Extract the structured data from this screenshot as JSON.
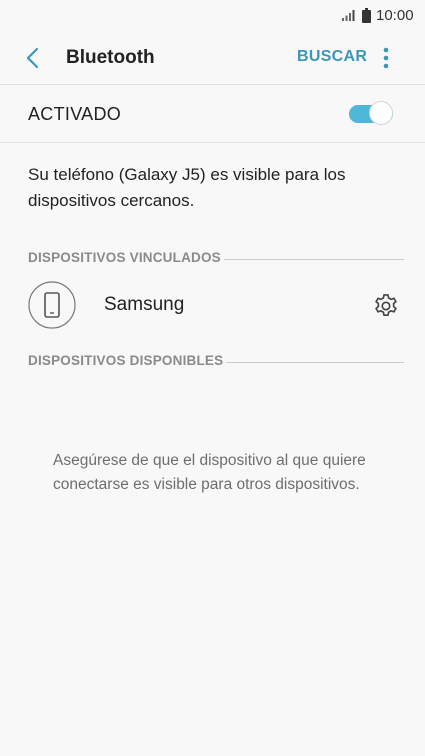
{
  "status_bar": {
    "time": "10:00",
    "icons": [
      "signal-icon",
      "battery-icon"
    ]
  },
  "app_bar": {
    "back_icon": "back-arrow-icon",
    "title": "Bluetooth",
    "action_label": "BUSCAR",
    "more_icon": "more-vert-icon"
  },
  "master_switch": {
    "label": "ACTIVADO",
    "state": "on"
  },
  "visibility_text": "Su teléfono (Galaxy J5) es visible para los dispositivos cercanos.",
  "sections": {
    "paired": {
      "title": "DISPOSITIVOS VINCULADOS",
      "devices": [
        {
          "name": "Samsung",
          "icon": "phone-icon",
          "settings_icon": "gear-icon"
        }
      ]
    },
    "available": {
      "title": "DISPOSITIVOS DISPONIBLES",
      "empty_hint": "Asegúrese de que el dispositivo al que quiere conectarse es visible para otros dispositivos."
    }
  },
  "colors": {
    "accent": "#3a97b8",
    "toggle_on": "#4eb6d8",
    "background": "#f8f8f8",
    "section_label": "#8a8a8a",
    "hint_text": "#6e6e6e"
  }
}
